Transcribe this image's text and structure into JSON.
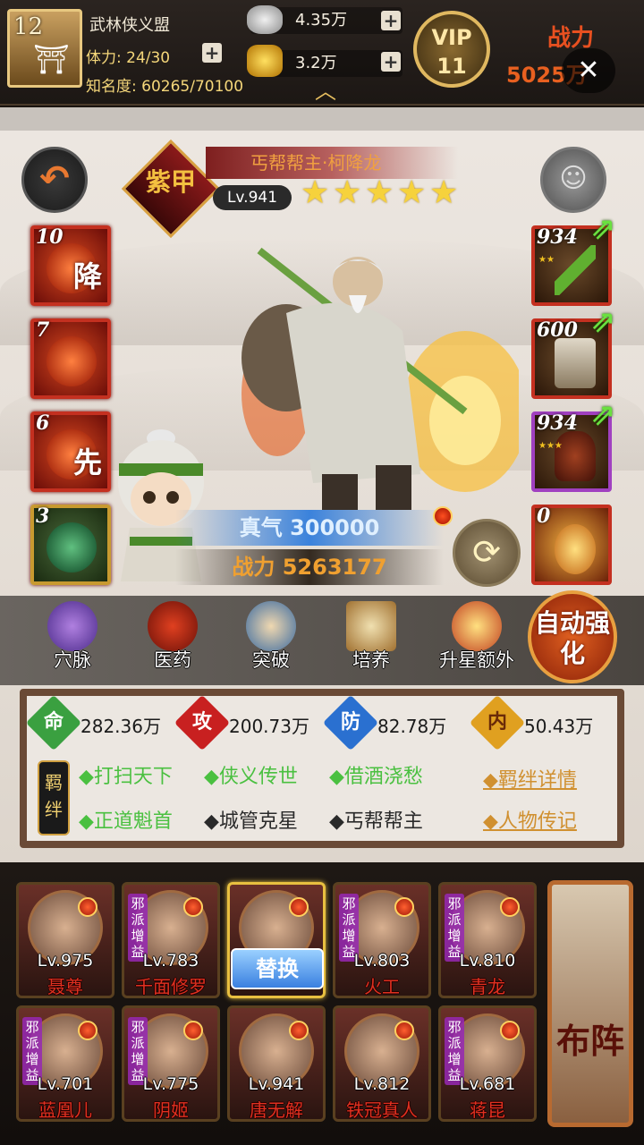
{
  "topbar": {
    "level": "12",
    "guild": "武林侠义盟",
    "stamina": "体力: 24/30",
    "fame": "知名度: 60265/70100",
    "silver": "4.35万",
    "gold": "3.2万",
    "vip_label": "VIP",
    "vip_level": "11",
    "power_label": "战力",
    "power_value": "5025万"
  },
  "hero": {
    "title": "丐帮帮主·柯降龙",
    "rank": "紫甲",
    "level": "Lv.941",
    "stars": 5,
    "zhenqi": "真气 300000",
    "power": "战力 5263177"
  },
  "skills": [
    {
      "count": "10",
      "glyph": "降"
    },
    {
      "count": "7",
      "glyph": ""
    },
    {
      "count": "6",
      "glyph": "先"
    },
    {
      "count": "3",
      "glyph": ""
    }
  ],
  "equips": [
    {
      "count": "934"
    },
    {
      "count": "600"
    },
    {
      "count": "934"
    },
    {
      "count": "0"
    }
  ],
  "functions": [
    {
      "label": "穴脉"
    },
    {
      "label": "医药"
    },
    {
      "label": "突破"
    },
    {
      "label": "培养"
    },
    {
      "label": "升星额外"
    }
  ],
  "auto_button": "自动强化",
  "stats": [
    {
      "glyph": "命",
      "value": "282.36万",
      "color": "#3aa040"
    },
    {
      "glyph": "攻",
      "value": "200.73万",
      "color": "#c82020"
    },
    {
      "glyph": "防",
      "value": "82.78万",
      "color": "#2a70d0"
    },
    {
      "glyph": "内",
      "value": "50.43万",
      "color": "#e0a020"
    }
  ],
  "jiban_tag": "羁绊",
  "fates": [
    {
      "text": "◆打扫天下",
      "active": true
    },
    {
      "text": "◆侠义传世",
      "active": true
    },
    {
      "text": "◆借酒浇愁",
      "active": true
    },
    {
      "text": "◆正道魁首",
      "active": true
    },
    {
      "text": "◆城管克星",
      "active": false
    },
    {
      "text": "◆丐帮帮主",
      "active": false
    }
  ],
  "links": {
    "fate_detail": "◆羁绊详情",
    "biography": "◆人物传记"
  },
  "team": [
    {
      "level": "Lv.975",
      "name": "聂尊",
      "tag": ""
    },
    {
      "level": "Lv.783",
      "name": "千面修罗",
      "tag": "邪派增益"
    },
    {
      "level": "",
      "name": "",
      "tag": ""
    },
    {
      "level": "Lv.803",
      "name": "火工",
      "tag": "邪派增益"
    },
    {
      "level": "Lv.810",
      "name": "青龙",
      "tag": "邪派增益"
    },
    {
      "level": "Lv.701",
      "name": "蓝凰儿",
      "tag": "邪派增益"
    },
    {
      "level": "Lv.775",
      "name": "阴姬",
      "tag": "邪派增益"
    },
    {
      "level": "Lv.941",
      "name": "唐无解",
      "tag": ""
    },
    {
      "level": "Lv.812",
      "name": "铁冠真人",
      "tag": ""
    },
    {
      "level": "Lv.681",
      "name": "蒋昆",
      "tag": "邪派增益"
    }
  ],
  "swap_button": "替换",
  "formation_button": "布阵"
}
